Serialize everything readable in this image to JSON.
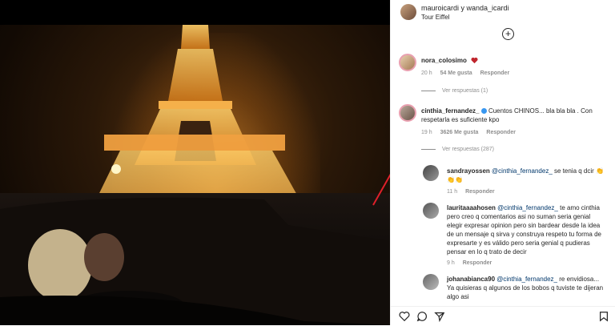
{
  "post": {
    "header": {
      "usernames": "mauroicardi y wanda_icardi",
      "location": "Tour Eiffel"
    },
    "comments": [
      {
        "username": "nora_colosimo",
        "text": "",
        "has_heart": true,
        "time": "20 h",
        "likes": "54 Me gusta",
        "reply_label": "Responder",
        "view_replies": "Ver respuestas (1)"
      },
      {
        "username": "cinthia_fernandez_",
        "verified": true,
        "text": "Cuentos CHINOS... bla bla bla . Con respetarla es suficiente kpo",
        "time": "19 h",
        "likes": "3626 Me gusta",
        "reply_label": "Responder",
        "view_replies": "Ver respuestas (287)"
      }
    ],
    "replies": [
      {
        "username": "sandrayossen",
        "mention": "@cinthia_fernandez_",
        "text": "se tenia q dcir 👏👏👏",
        "time": "11 h",
        "reply_label": "Responder"
      },
      {
        "username": "lauritaaaahosen",
        "mention": "@cinthia_fernandez_",
        "text": "te amo cinthia pero creo q comentarios asi no suman seria genial elegir expresar opinion pero sin bardear desde la idea de un mensaje q sirva y construya respeto tu forma de expresarte y es válido pero seria genial q pudieras pensar en lo q trato de decir",
        "time": "9 h",
        "reply_label": "Responder"
      },
      {
        "username": "johanabianca90",
        "mention": "@cinthia_fernandez_",
        "text": "re envidiosa... Ya quisieras q algunos de los bobos q tuviste te dijeran algo asi"
      }
    ],
    "colors": {
      "accent_red": "#ed4956",
      "verified_blue": "#3897f0",
      "arrow_red": "#e0202a"
    }
  }
}
